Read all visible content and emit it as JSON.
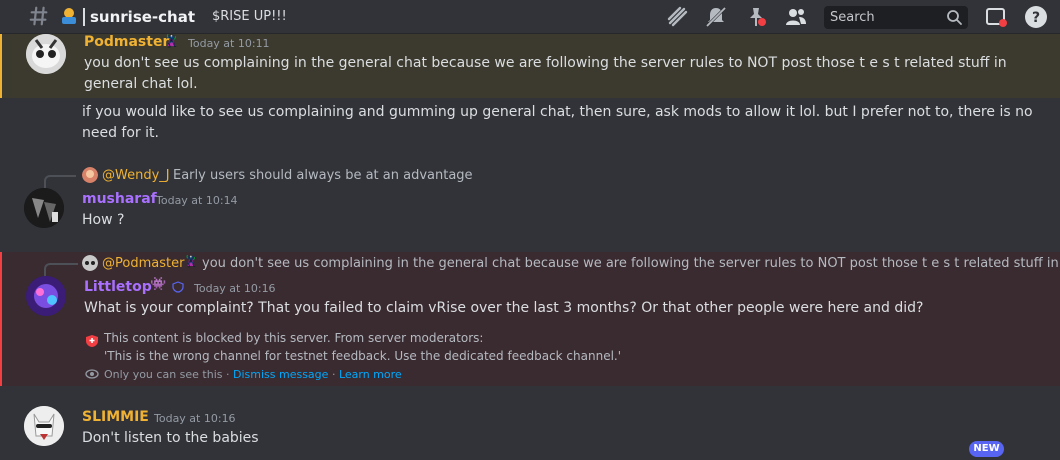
{
  "header": {
    "channel_name": "sunrise-chat",
    "topic": "$RISE UP!!!",
    "search_placeholder": "Search"
  },
  "messages": [
    {
      "author": "Podmaster",
      "author_color": "#f0b232",
      "badge": "🦹",
      "timestamp": "Today at 10:11",
      "lines": [
        "you don't see us complaining in the general chat because we are following the server rules to NOT post those t e s t related stuff in",
        "general chat lol.",
        "if you would like to see us complaining and gumming up general chat, then sure, ask mods to allow it lol. but I prefer not to, there is no",
        "need for it."
      ]
    },
    {
      "reply_to": "@Wendy_J",
      "reply_text": "Early users should always be at an advantage",
      "author": "musharaf",
      "author_color": "#a970ff",
      "timestamp": "Today at 10:14",
      "text": "How ?"
    },
    {
      "reply_to": "@Podmaster",
      "reply_badge": "🦹",
      "reply_text": "you don't see us complaining in the general chat because we are following the server rules to NOT post those t e s t related stuff in ge...",
      "author": "Littletop",
      "author_color": "#a970ff",
      "badge": "👾",
      "timestamp": "Today at 10:16",
      "text": "What is your complaint? That  you failed to claim vRise over the last 3 months? Or that other people were here and did?",
      "blocked_line1": "This content is blocked by this server. From server moderators:",
      "blocked_line2": "'This is the wrong channel for testnet feedback. Use the dedicated feedback channel.'",
      "ephemeral_note": "Only you can see this",
      "dismiss": "Dismiss message",
      "learn_more": "Learn more"
    },
    {
      "author": "SLIMMIE",
      "author_color": "#f0b232",
      "timestamp": "Today at 10:16",
      "text": "Don't listen to the babies"
    }
  ],
  "new_badge": "NEW"
}
